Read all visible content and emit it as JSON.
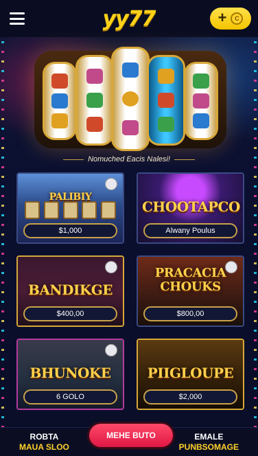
{
  "header": {
    "logo": "yy77",
    "coin_plus": "+",
    "coin_label": "C"
  },
  "hero": {
    "caption": "Nomuched Eacis Nalesi!"
  },
  "games": [
    {
      "title": "PALIBIY",
      "amount": "$1,000"
    },
    {
      "title": "CHOOTAPCO",
      "amount": "Alwany Poulus"
    },
    {
      "title": "BANDIKGE",
      "amount": "$400,00"
    },
    {
      "title": "PRACACIA CHOUKS",
      "amount": "$800,00"
    },
    {
      "title": "BHUNOKE",
      "amount": "6 GOLO"
    },
    {
      "title": "PIIGLOUPE",
      "amount": "$2,000"
    }
  ],
  "bottom_nav": {
    "left_line1": "ROBTA",
    "left_line2": "MAUA SLOO",
    "center": "MEHE BUTO",
    "right_line1": "EMALE",
    "right_line2": "PUNBSOMAGE"
  },
  "colors": {
    "accent_yellow": "#ffd21a",
    "cta_red": "#e01744",
    "background": "#0b0f24"
  }
}
